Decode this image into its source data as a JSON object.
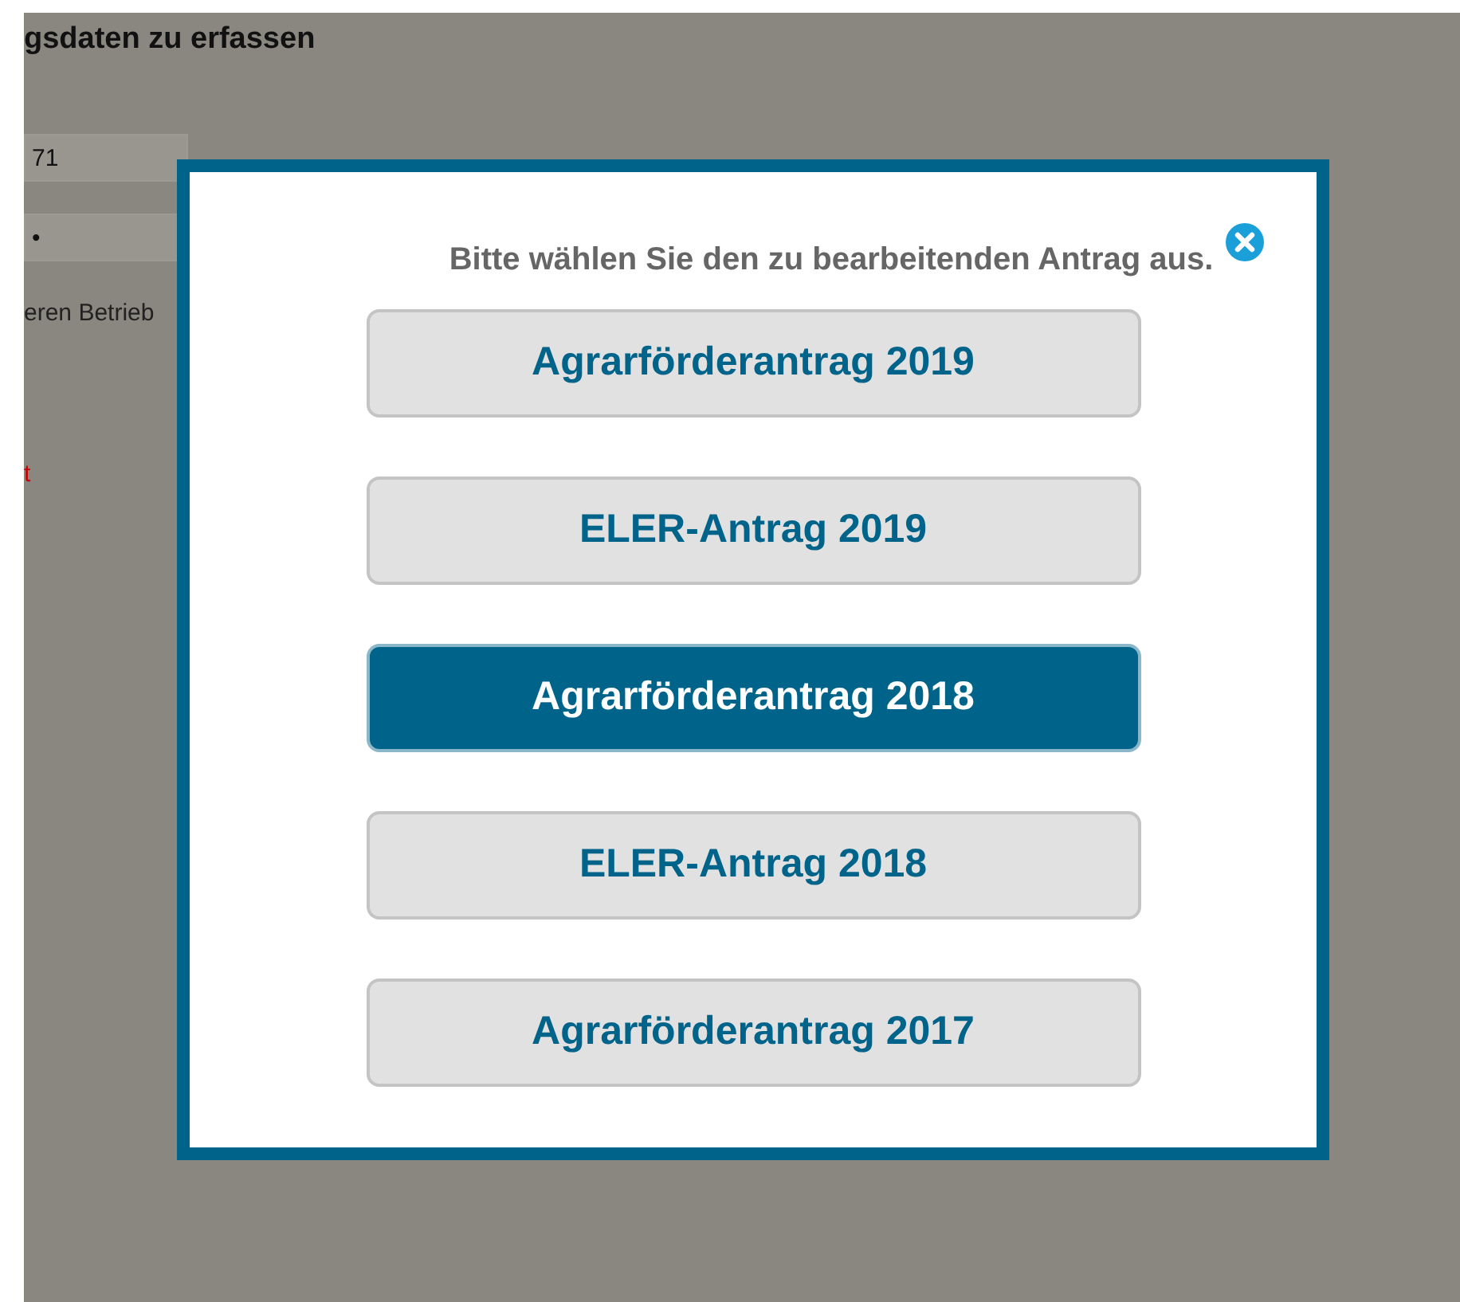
{
  "background_page": {
    "heading": "gsdaten zu erfassen",
    "field_1": {
      "value": "71"
    },
    "field_2": {
      "value": "•"
    },
    "text_1": "eren Betrieb",
    "text_2": "t"
  },
  "dialog": {
    "title": "Bitte wählen Sie den zu bearbeitenden Antrag aus.",
    "options": [
      {
        "label": "Agrarförderantrag 2019",
        "selected": false
      },
      {
        "label": "ELER-Antrag 2019",
        "selected": false
      },
      {
        "label": "Agrarförderantrag 2018",
        "selected": true
      },
      {
        "label": "ELER-Antrag 2018",
        "selected": false
      },
      {
        "label": "Agrarförderantrag 2017",
        "selected": false
      }
    ]
  }
}
